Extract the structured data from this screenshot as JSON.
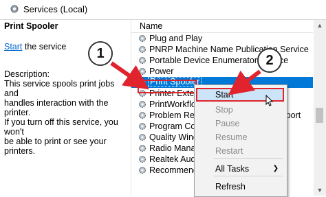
{
  "window": {
    "title": "Services (Local)"
  },
  "details": {
    "service_name": "Print Spooler",
    "start_link": "Start",
    "start_suffix": " the service",
    "description_label": "Description:",
    "description_lines": [
      "This service spools print jobs and",
      "handles interaction with the printer.",
      "If you turn off this service, you won't",
      "be able to print or see your printers."
    ]
  },
  "list": {
    "column_name": "Name",
    "rows": [
      {
        "name": "Plug and Play"
      },
      {
        "name": "PNRP Machine Name Publication Service"
      },
      {
        "name": "Portable Device Enumerator Service"
      },
      {
        "name": "Power"
      },
      {
        "name": "Print Spooler",
        "selected": true
      },
      {
        "name": "Printer Extensions and Notifications"
      },
      {
        "name": "PrintWorkflow"
      },
      {
        "name": "Problem Reports Control Panel Support"
      },
      {
        "name": "Program Compatibility Assistant"
      },
      {
        "name": "Quality Windows Audio Video"
      },
      {
        "name": "Radio Management Service"
      },
      {
        "name": "Realtek Audio Universal Service"
      },
      {
        "name": "Recommended Troubleshooting"
      }
    ]
  },
  "context_menu": {
    "items": [
      {
        "label": "Start",
        "enabled": true,
        "highlighted": true
      },
      {
        "label": "Stop",
        "enabled": false
      },
      {
        "label": "Pause",
        "enabled": false
      },
      {
        "label": "Resume",
        "enabled": false
      },
      {
        "label": "Restart",
        "enabled": false
      },
      {
        "label": "All Tasks",
        "enabled": true,
        "submenu": true
      },
      {
        "label": "Refresh",
        "enabled": true
      }
    ]
  },
  "callouts": {
    "step1": "1",
    "step2": "2"
  },
  "colors": {
    "selection": "#0078d7",
    "callout_red": "#e0232d",
    "link": "#0066cc"
  },
  "icons": {
    "title": "services-gear-icon",
    "row": "gear-icon"
  }
}
